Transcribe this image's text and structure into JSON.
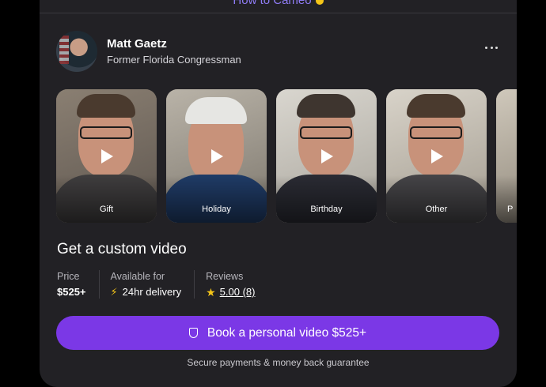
{
  "top_link": {
    "label": "How to Cameo"
  },
  "profile": {
    "name": "Matt Gaetz",
    "title": "Former Florida Congressman"
  },
  "tiles": [
    {
      "label": "Gift",
      "icon": "play-icon"
    },
    {
      "label": "Holiday",
      "icon": "play-icon"
    },
    {
      "label": "Birthday",
      "icon": "play-icon"
    },
    {
      "label": "Other",
      "icon": "play-icon"
    },
    {
      "label": "P",
      "icon": "play-icon"
    }
  ],
  "custom_video": {
    "heading": "Get a custom video",
    "price_label": "Price",
    "price_value": "$525+",
    "availability_label": "Available for",
    "availability_value": "24hr delivery",
    "reviews_label": "Reviews",
    "reviews_value": "5.00 (8)"
  },
  "book_button": {
    "label": "Book a personal video $525+"
  },
  "footnote": "Secure payments & money back guarantee",
  "colors": {
    "card_bg": "#222125",
    "accent_purple": "#7b38e6",
    "link_purple": "#8f7cf5",
    "star_yellow": "#f5c518"
  }
}
